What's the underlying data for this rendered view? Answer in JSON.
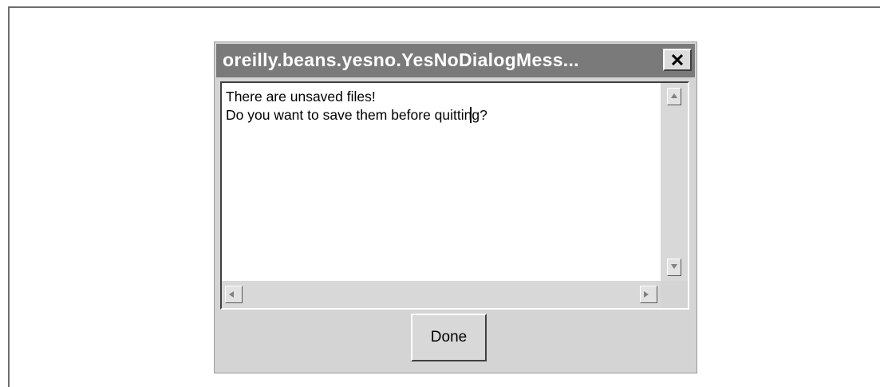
{
  "dialog": {
    "title": "oreilly.beans.yesno.YesNoDialogMess...",
    "close_glyph": "✕",
    "message_lines": [
      "There are unsaved files!",
      "Do you want to save them before quitting?"
    ],
    "done_label": "Done"
  },
  "colors": {
    "titlebar": "#7a7a7a",
    "dialog_bg": "#d4d4d4",
    "text_bg": "#ffffff"
  },
  "icons": {
    "close": "close-icon",
    "scroll_up": "arrow-up-icon",
    "scroll_down": "arrow-down-icon",
    "scroll_left": "arrow-left-icon",
    "scroll_right": "arrow-right-icon"
  }
}
